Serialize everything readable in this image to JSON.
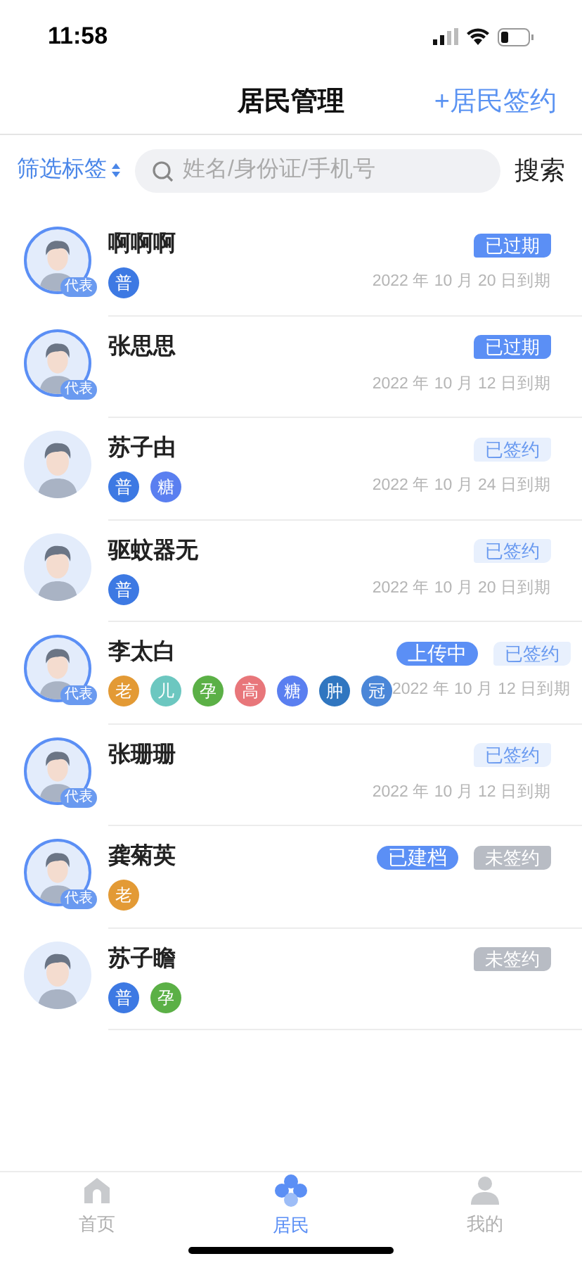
{
  "status_bar": {
    "time": "11:58"
  },
  "header": {
    "title": "居民管理",
    "action": "+居民签约"
  },
  "filter": {
    "label": "筛选标签",
    "search_placeholder": "姓名/身份证/手机号",
    "search_button": "搜索"
  },
  "residents": [
    {
      "name": "啊啊啊",
      "representative": true,
      "representative_label": "代表",
      "status": {
        "kind": "expired",
        "label": "已过期"
      },
      "tags": [
        {
          "label": "普",
          "color": "#3d79e3"
        }
      ],
      "due": "2022 年 10 月 20 日到期"
    },
    {
      "name": "张思思",
      "representative": true,
      "representative_label": "代表",
      "status": {
        "kind": "expired",
        "label": "已过期"
      },
      "due": "2022 年 10 月 12 日到期"
    },
    {
      "name": "苏子由",
      "representative": false,
      "status": {
        "kind": "signed",
        "label": "已签约"
      },
      "tags": [
        {
          "label": "普",
          "color": "#3d79e3"
        },
        {
          "label": "糖",
          "color": "#5a7ff0"
        }
      ],
      "due": "2022 年 10 月 24 日到期"
    },
    {
      "name": "驱蚊器无",
      "representative": false,
      "status": {
        "kind": "signed",
        "label": "已签约"
      },
      "tags": [
        {
          "label": "普",
          "color": "#3d79e3"
        }
      ],
      "due": "2022 年 10 月 20 日到期"
    },
    {
      "name": "李太白",
      "representative": true,
      "representative_label": "代表",
      "extra": "上传中",
      "status": {
        "kind": "signed",
        "label": "已签约"
      },
      "tags": [
        {
          "label": "老",
          "color": "#e39a35"
        },
        {
          "label": "儿",
          "color": "#6cc7c0"
        },
        {
          "label": "孕",
          "color": "#5bb046"
        },
        {
          "label": "高",
          "color": "#e8767a"
        },
        {
          "label": "糖",
          "color": "#5a7ff0"
        },
        {
          "label": "肿",
          "color": "#3076c0"
        },
        {
          "label": "冠",
          "color": "#4a86d8"
        }
      ],
      "due": "2022 年 10 月 12 日到期"
    },
    {
      "name": "张珊珊",
      "representative": true,
      "representative_label": "代表",
      "status": {
        "kind": "signed",
        "label": "已签约"
      },
      "due": "2022 年 10 月 12 日到期"
    },
    {
      "name": "龚菊英",
      "representative": true,
      "representative_label": "代表",
      "extra": "已建档",
      "status": {
        "kind": "unsigned",
        "label": "未签约"
      },
      "tags": [
        {
          "label": "老",
          "color": "#e39a35"
        }
      ]
    },
    {
      "name": "苏子瞻",
      "representative": false,
      "status": {
        "kind": "unsigned",
        "label": "未签约"
      },
      "tags": [
        {
          "label": "普",
          "color": "#3d79e3"
        },
        {
          "label": "孕",
          "color": "#5bb046"
        }
      ]
    }
  ],
  "tab_bar": [
    {
      "label": "首页",
      "selected": false
    },
    {
      "label": "居民",
      "selected": true
    },
    {
      "label": "我的",
      "selected": false
    }
  ]
}
